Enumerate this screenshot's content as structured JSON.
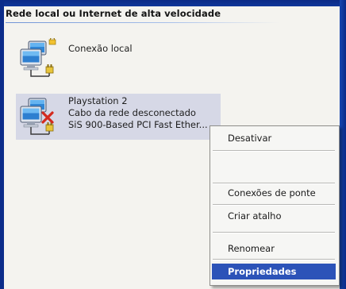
{
  "group": {
    "title": "Rede local ou Internet de alta velocidade"
  },
  "connections": [
    {
      "name": "Conexão local",
      "icon": "network-connection-icon"
    },
    {
      "name": "Playstation 2",
      "status": "Cabo da rede desconectado",
      "device": "SiS 900-Based PCI Fast Ether...",
      "icon": "network-disconnected-icon"
    }
  ],
  "context_menu": {
    "items": [
      {
        "label": "Desativar"
      },
      {
        "label": "Conexões de ponte"
      },
      {
        "label": "Criar atalho"
      },
      {
        "label": "Renomear"
      },
      {
        "label": "Propriedades",
        "selected": true
      }
    ]
  },
  "colors": {
    "desktop": "#0c2f8c",
    "selection": "#2c53b8",
    "item_highlight": "#d6d8e6"
  }
}
